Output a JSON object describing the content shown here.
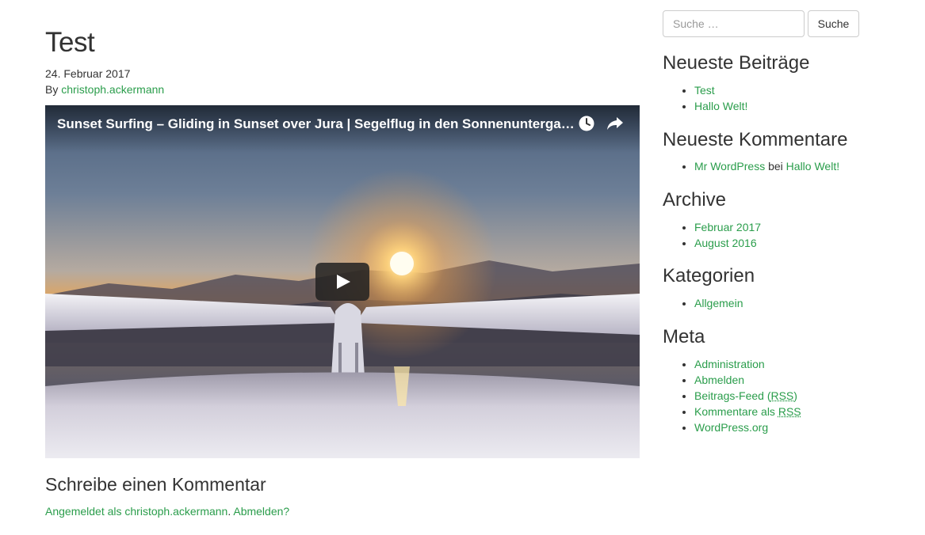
{
  "post": {
    "title": "Test",
    "date": "24. Februar 2017",
    "author_prefix": "By",
    "author": "christoph.ackermann"
  },
  "video": {
    "title": "Sunset Surfing – Gliding in Sunset over Jura | Segelflug in den Sonnenuntergang...",
    "icons": [
      "clock-icon",
      "share-icon",
      "play-icon"
    ],
    "colors": {
      "play_button": "#212121",
      "title_text": "#ffffff"
    }
  },
  "comments": {
    "heading": "Schreibe einen Kommentar",
    "logged_in_as": "Angemeldet als christoph.ackermann",
    "separator": ".",
    "logout": "Abmelden?"
  },
  "search": {
    "placeholder": "Suche …",
    "button": "Suche"
  },
  "widgets": {
    "recent_posts": {
      "title": "Neueste Beiträge",
      "items": [
        "Test",
        "Hallo Welt!"
      ]
    },
    "recent_comments": {
      "title": "Neueste Kommentare",
      "author": "Mr WordPress",
      "connector": "bei",
      "post": "Hallo Welt!"
    },
    "archives": {
      "title": "Archive",
      "items": [
        "Februar 2017",
        "August 2016"
      ]
    },
    "categories": {
      "title": "Kategorien",
      "items": [
        "Allgemein"
      ]
    },
    "meta": {
      "title": "Meta",
      "administration": "Administration",
      "logout": "Abmelden",
      "entries_feed": "Beitrags-Feed (",
      "entries_rss": "RSS",
      "entries_close": ")",
      "comments_feed": "Kommentare als ",
      "comments_rss": "RSS",
      "wordpress": "WordPress.org"
    }
  },
  "colors": {
    "link": "#2a9d4b",
    "text": "#333333"
  }
}
